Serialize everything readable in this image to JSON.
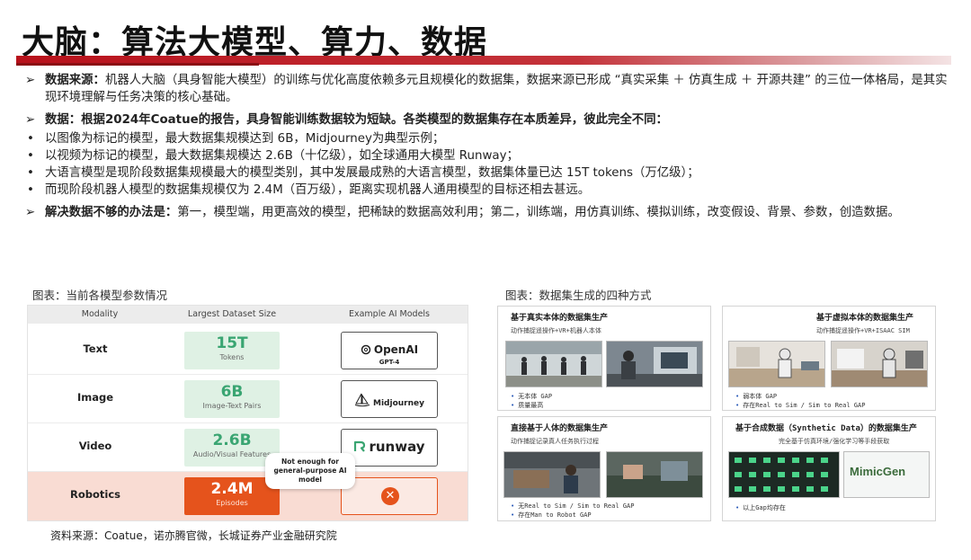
{
  "title": "大脑：算法大模型、算力、数据",
  "paragraphs": {
    "p1_mark": "➢",
    "p1_bold": "数据来源：",
    "p1_text": "机器人大脑（具身智能大模型）的训练与优化高度依赖多元且规模化的数据集，数据来源已形成 “真实采集 ＋ 仿真生成 ＋ 开源共建” 的三位一体格局，是其实现环境理解与任务决策的核心基础。",
    "p2_mark": "➢",
    "p2_bold": "数据：根据2024年Coatue的报告，具身智能训练数据较为短缺。各类模型的数据集存在本质差异，彼此完全不同：",
    "bullet_mark": "•",
    "bullets": [
      "以图像为标记的模型，最大数据集规模达到 6B，Midjourney为典型示例；",
      "以视频为标记的模型，最大数据集规模达 2.6B（十亿级），如全球通用大模型 Runway；",
      "大语言模型是现阶段数据集规模最大的模型类别，其中发展最成熟的大语言模型，数据集体量已达 15T tokens（万亿级）；",
      "而现阶段机器人模型的数据集规模仅为 2.4M（百万级），距离实现机器人通用模型的目标还相去甚远。"
    ],
    "p3_mark": "➢",
    "p3_bold": "解决数据不够的办法是：",
    "p3_text": "第一，模型端，用更高效的模型，把稀缺的数据高效利用；第二，训练端，用仿真训练、模拟训练，改变假设、背景、参数，创造数据。"
  },
  "captions": {
    "left": "图表：当前各模型参数情况",
    "right": "图表：数据集生成的四种方式"
  },
  "dataset_table": {
    "headers": [
      "Modality",
      "Largest Dataset Size",
      "Example AI Models"
    ],
    "rows": [
      {
        "modality": "Text",
        "size": "15T",
        "unit": "Tokens",
        "model": "OpenAI",
        "model_sub": "GPT-4"
      },
      {
        "modality": "Image",
        "size": "6B",
        "unit": "Image-Text Pairs",
        "model": "Midjourney",
        "model_sub": ""
      },
      {
        "modality": "Video",
        "size": "2.6B",
        "unit": "Audio/Visual Features",
        "model": "runway",
        "model_sub": ""
      },
      {
        "modality": "Robotics",
        "size": "2.4M",
        "unit": "Episodes",
        "model": "✕",
        "model_sub": ""
      }
    ],
    "callout": "Not enough for general-purpose AI model",
    "colors": {
      "green_box": "#dff1e4",
      "green_text": "#3aa572",
      "robot_row": "#f9dcd3",
      "robot_box": "#e5531c"
    }
  },
  "panels": [
    {
      "title": "基于真实本体的数据集生产",
      "sub": "动作捕捉遥操作+VR+机器人本体",
      "bullets": [
        "无本体 GAP",
        "质量最高"
      ]
    },
    {
      "title": "基于虚拟本体的数据集生产",
      "sub": "动作捕捉遥操作+VR+ISAAC SIM",
      "bullets": [
        "弱本体 GAP",
        "存在Real to Sim / Sim to Real GAP"
      ]
    },
    {
      "title": "直接基于人体的数据集生产",
      "sub": "动作捕捉记录真人任务执行过程",
      "bullets": [
        "无Real to Sim / Sim to Real GAP",
        "存在Man to Robot GAP"
      ]
    },
    {
      "title": "基于合成数据（Synthetic Data）的数据集生产",
      "sub": "完全基于仿真环境/强化学习等手段获取",
      "bullets": [
        "以上Gap均存在"
      ],
      "logo": "MimicGen"
    }
  ],
  "source": "资料来源：Coatue，诺亦腾官微，长城证券产业金融研究院",
  "colors": {
    "accent_red": "#b8111b",
    "bullet_blue": "#2a5ab8"
  }
}
